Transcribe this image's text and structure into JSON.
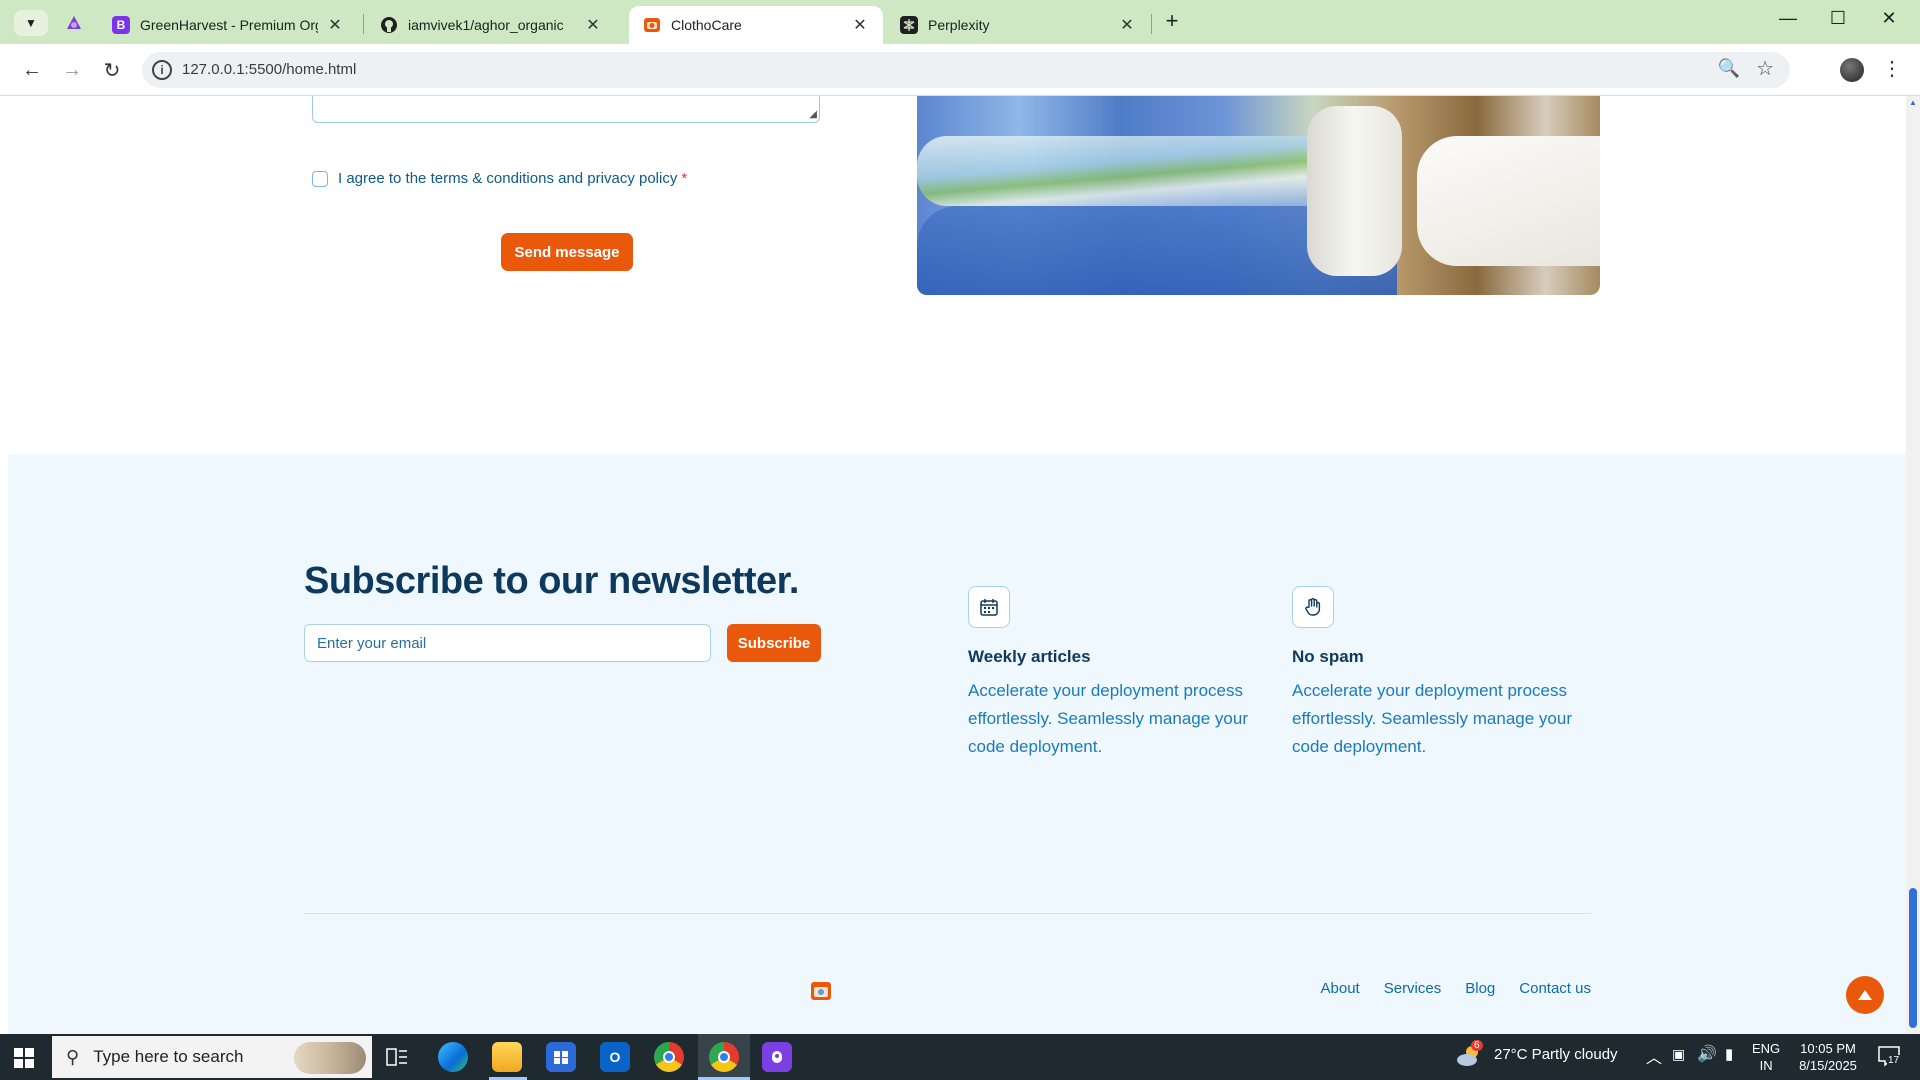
{
  "browser": {
    "tabs": [
      {
        "title": "GreenHarvest - Premium Organ",
        "favicon": "bootstrap-b",
        "active": false
      },
      {
        "title": "iamvivek1/aghor_organic",
        "favicon": "github-icon",
        "active": false
      },
      {
        "title": "ClothoCare",
        "favicon": "clothocare-logo",
        "active": true
      },
      {
        "title": "Perplexity",
        "favicon": "perplexity-icon",
        "active": false
      }
    ],
    "url": "127.0.0.1:5500/home.html"
  },
  "form": {
    "agree_text": "I agree to the terms & conditions and privacy policy",
    "required_mark": "*",
    "send_label": "Send message"
  },
  "newsletter": {
    "title": "Subscribe to our newsletter.",
    "email_placeholder": "Enter your email",
    "subscribe_label": "Subscribe",
    "features": [
      {
        "icon": "calendar-icon",
        "title": "Weekly articles",
        "desc": "Accelerate your deployment process effortlessly. Seamlessly manage your code deployment."
      },
      {
        "icon": "hand-icon",
        "title": "No spam",
        "desc": "Accelerate your deployment process effortlessly. Seamlessly manage your code deployment."
      }
    ]
  },
  "footer": {
    "links": [
      "About",
      "Services",
      "Blog",
      "Contact us"
    ]
  },
  "taskbar": {
    "search_placeholder": "Type here to search",
    "weather": "27°C  Partly cloudy",
    "weather_badge": "6",
    "lang_1": "ENG",
    "lang_2": "IN",
    "time": "10:05 PM",
    "date": "8/15/2025",
    "notifications": "17"
  },
  "colors": {
    "accent": "#ea580c",
    "heading": "#0d3a5c",
    "link": "#0e6aa8",
    "newsletter_bg": "#eff8ff"
  }
}
